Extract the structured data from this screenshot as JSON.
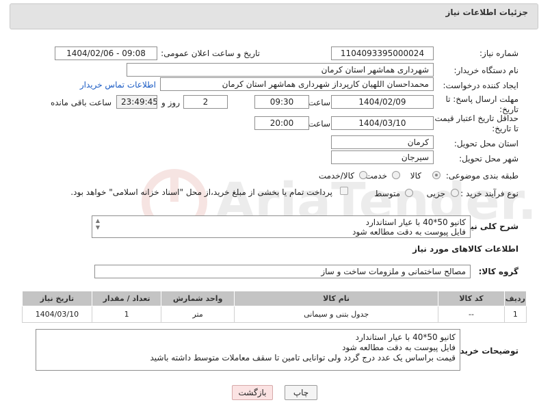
{
  "header": {
    "title": "جزئیات اطلاعات نیاز"
  },
  "labels": {
    "need_number": "شماره نیاز:",
    "announce_datetime": "تاریخ و ساعت اعلان عمومی:",
    "buyer_org": "نام دستگاه خریدار:",
    "requester": "ایجاد کننده درخواست:",
    "reply_deadline": "مهلت ارسال پاسخ: تا تاریخ:",
    "hour": "ساعت",
    "day_and": "روز و",
    "remaining": "ساعت باقی مانده",
    "price_validity": "حداقل تاریخ اعتبار قیمت: تا تاریخ:",
    "province": "استان محل تحویل:",
    "city": "شهر محل تحویل:",
    "category": "طبقه بندی موضوعی:",
    "process_type": "نوع فرآیند خرید :",
    "description": "شرح کلی نیاز:",
    "goods_info": "اطلاعات کالاهای مورد نیاز",
    "goods_group": "گروه کالا:",
    "buyer_notes": "توضیحات خریدار:"
  },
  "values": {
    "need_number": "1104093395000024",
    "announce_datetime": "1404/02/06 - 09:08",
    "buyer_org": "شهرداری هماشهر استان کرمان",
    "requester": "محمداحسان اللهیان کارپرداز  شهرداری هماشهر استان کرمان",
    "contact_link": "اطلاعات تماس خریدار",
    "reply_date": "1404/02/09",
    "reply_time": "09:30",
    "days": "2",
    "remaining_time": "23:49:45",
    "validity_date": "1404/03/10",
    "validity_time": "20:00",
    "province": "کرمان",
    "city": "سیرجان",
    "category_options": [
      "کالا",
      "خدمت",
      "کالا/خدمت"
    ],
    "process_options": [
      "جزیی",
      "متوسط"
    ],
    "payment_note": "پرداخت تمام یا بخشی از مبلغ خرید،از محل \"اسناد خزانه اسلامی\" خواهد بود.",
    "description_lines": [
      "کانیو 50*40 با عیار استاندارد",
      "فایل پیوست به دقت مطالعه شود"
    ],
    "goods_group": "مصالح ساختمانی و ملزومات ساخت و ساز",
    "notes_lines": [
      "کانیو 50*40 با عیار استاندارد",
      "فایل پیوست به دقت مطالعه شود",
      "قیمت براساس یک عدد درج گردد ولی توانایی تامین تا سقف معاملات متوسط داشته باشید"
    ]
  },
  "table": {
    "headers": [
      "ردیف",
      "کد کالا",
      "نام کالا",
      "واحد شمارش",
      "تعداد / مقدار",
      "تاریخ نیاز"
    ],
    "rows": [
      [
        "1",
        "--",
        "جدول بتنی و سیمانی",
        "متر",
        "1",
        "1404/03/10"
      ]
    ]
  },
  "buttons": {
    "print": "چاپ",
    "back": "بازگشت"
  },
  "watermark": "AriaTender.neT"
}
